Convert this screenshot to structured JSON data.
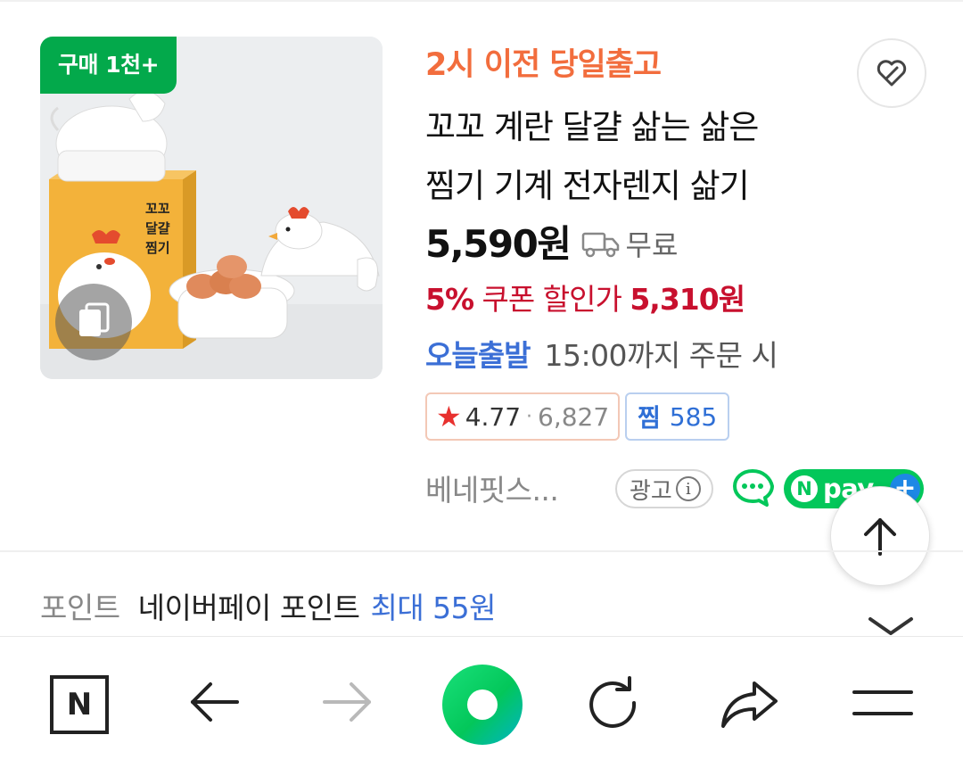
{
  "product": {
    "buy_badge": "구매 1천+",
    "ship_label": "2시 이전 당일출고",
    "title_line1": "꼬꼬 계란 달걀 삶는 삶은",
    "title_line2": "찜기 기계 전자렌지 삶기",
    "price": "5,590원",
    "shipping_fee": "무료",
    "coupon": {
      "percent": "5%",
      "label": "쿠폰 할인가",
      "price": "5,310원"
    },
    "today_badge": "오늘출발",
    "today_desc": "15:00까지 주문 시",
    "rating": {
      "score": "4.77",
      "separator": "·",
      "count": "6,827"
    },
    "zzim": {
      "label": "찜",
      "count": "585"
    },
    "seller": "베네핏스...",
    "ad_label": "광고",
    "npay_label": "pay",
    "image_box_text": "꼬꼬 달걀 찜기"
  },
  "point": {
    "label": "포인트",
    "name": "네이버페이 포인트",
    "max": "최대 55원"
  },
  "bottom_bar": {
    "home_label": "N"
  },
  "colors": {
    "green": "#03a94b",
    "orange": "#f26d3d",
    "coupon_red": "#c8102e",
    "blue": "#3b6fd6",
    "npay_green": "#03c75a"
  },
  "icons": [
    "copy-icon",
    "heart-link-icon",
    "truck-icon",
    "star-icon",
    "info-icon",
    "talk-icon",
    "arrow-up-icon",
    "chevron-down-icon",
    "back-arrow-icon",
    "forward-arrow-icon",
    "reload-icon",
    "share-icon",
    "menu-icon"
  ]
}
